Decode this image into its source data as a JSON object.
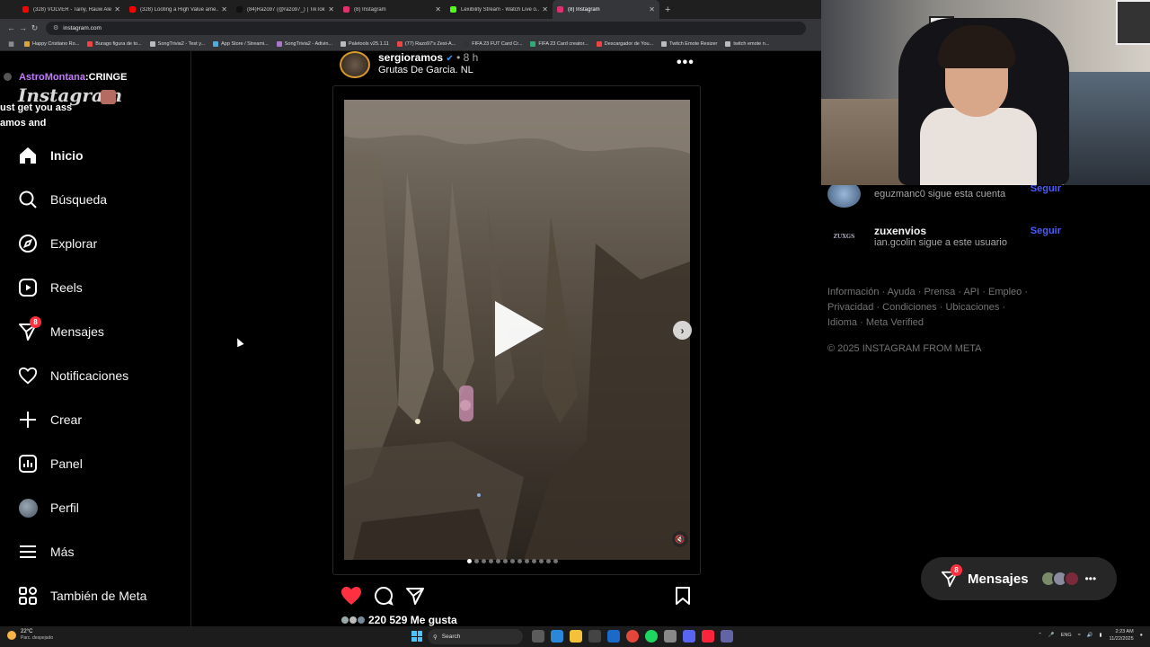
{
  "browser": {
    "tabs": [
      {
        "title": "(328) VOLVER - Tainy, Rauw Ale...",
        "color": "#ff0000"
      },
      {
        "title": "(328) Looting a High Value ame...",
        "color": "#ff0000"
      },
      {
        "title": "(84)Razo97 (@razo97_) | TikTok",
        "color": "#111111"
      },
      {
        "title": "(8) Instagram",
        "color": "#e1306c"
      },
      {
        "title": "Lexibility Stream - Watch Live o...",
        "color": "#53fc18"
      },
      {
        "title": "(8) Instagram",
        "color": "#e1306c",
        "active": true
      }
    ],
    "url": "instagram.com",
    "bookmarks": [
      {
        "label": "Happy Cristiano Ro...",
        "color": "#d9a441"
      },
      {
        "label": "Burago figura de to...",
        "color": "#e44"
      },
      {
        "label": "SongTrivia2 - Test y...",
        "color": "#bbb"
      },
      {
        "label": "App Store / Streami...",
        "color": "#5ad"
      },
      {
        "label": "SongTrivia2 - Adivin...",
        "color": "#a7c"
      },
      {
        "label": "Paletools v25.1.11",
        "color": "#bbb"
      },
      {
        "label": "(77) Razo97's Zest-A...",
        "color": "#e44"
      },
      {
        "label": "FIFA 23 FUT Card Cr...",
        "color": "#333"
      },
      {
        "label": "FIFA 23 Card creator...",
        "color": "#3a7"
      },
      {
        "label": "Descargador de You...",
        "color": "#e44"
      },
      {
        "label": "Twitch Emote Resizer",
        "color": "#bbb"
      },
      {
        "label": "twitch emote n...",
        "color": "#bbb"
      }
    ]
  },
  "chat": [
    {
      "user": "AstroMontana",
      "sep": " : ",
      "msg": "CRINGE"
    },
    {
      "user": "",
      "sep": "",
      "msg": ""
    },
    {
      "user": "",
      "sep": "",
      "msg": "ust get you ass"
    },
    {
      "user": "",
      "sep": "",
      "msg": "amos and"
    }
  ],
  "sidebar": {
    "logo": "Instagram",
    "items": [
      {
        "label": "Inicio",
        "icon": "home-icon",
        "active": true
      },
      {
        "label": "Búsqueda",
        "icon": "search-icon"
      },
      {
        "label": "Explorar",
        "icon": "compass-icon"
      },
      {
        "label": "Reels",
        "icon": "reels-icon"
      },
      {
        "label": "Mensajes",
        "icon": "messenger-icon",
        "badge": "8"
      },
      {
        "label": "Notificaciones",
        "icon": "heart-icon"
      },
      {
        "label": "Crear",
        "icon": "plus-icon"
      },
      {
        "label": "Panel",
        "icon": "dashboard-icon"
      },
      {
        "label": "Perfil",
        "icon": "avatar"
      },
      {
        "label": "Más",
        "icon": "menu-icon"
      },
      {
        "label": "También de Meta",
        "icon": "meta-apps-icon"
      }
    ]
  },
  "post": {
    "username": "sergioramos",
    "time": "• 8 h",
    "location": "Grutas De Garcia. NL",
    "more": "•••",
    "likes": "220 529 Me gusta",
    "carousel_count": 13,
    "carousel_index": 0
  },
  "suggestions": [
    {
      "name": "",
      "sub": "eguzmanc0 sigue esta cuenta",
      "follow": "Seguir"
    },
    {
      "name": "zuxenvios",
      "sub": "ian.gcolin sigue a este usuario",
      "follow": "Seguir",
      "logo": "ZUXGS"
    }
  ],
  "footer": {
    "links": [
      "Información",
      "Ayuda",
      "Prensa",
      "API",
      "Empleo",
      "Privacidad",
      "Condiciones",
      "Ubicaciones",
      "Idioma",
      "Meta Verified"
    ],
    "copyright": "© 2025 INSTAGRAM FROM META"
  },
  "messages_pill": {
    "label": "Mensajes",
    "badge": "8"
  },
  "taskbar": {
    "temp": "22°C",
    "weather": "Parc. despejado",
    "search": "Search",
    "lang": "ENG",
    "time": "2:23 AM",
    "date": "11/22/2025"
  },
  "colors": {
    "accent": "#4a5df9",
    "badge": "#ff3040",
    "like": "#ff3040",
    "chat_user": "#c57bff"
  }
}
